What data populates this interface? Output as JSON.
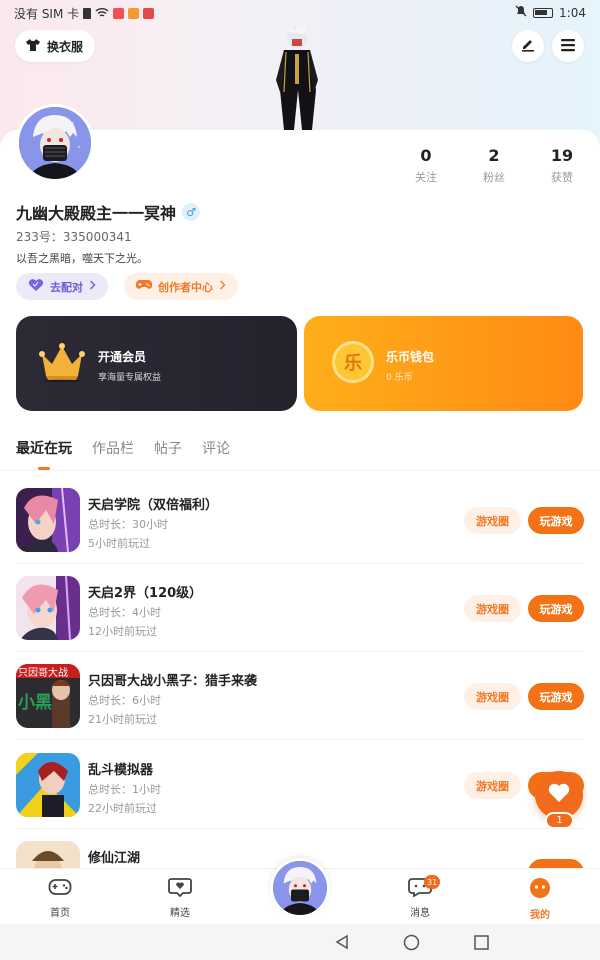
{
  "status_bar": {
    "carrier": "没有 SIM 卡",
    "time": "1:04"
  },
  "header": {
    "outfit_label": "换衣服"
  },
  "profile": {
    "name": "九幽大殿殿主一一冥神",
    "gender_symbol": "♂",
    "uid": "233号：335000341",
    "bio": "以吾之黑暗，噬天下之光。",
    "stats": [
      {
        "value": "0",
        "label": "关注"
      },
      {
        "value": "2",
        "label": "粉丝"
      },
      {
        "value": "19",
        "label": "获赞"
      }
    ],
    "match_label": "去配对",
    "creator_label": "创作者中心"
  },
  "cards": {
    "vip": {
      "title": "开通会员",
      "subtitle": "享海量专属权益"
    },
    "wallet": {
      "title": "乐币钱包",
      "subtitle": "0 乐币",
      "coin_glyph": "乐"
    }
  },
  "tabs": [
    "最近在玩",
    "作品栏",
    "帖子",
    "评论"
  ],
  "games": [
    {
      "name": "天启学院（双倍福利）",
      "duration": "总时长：30小时",
      "last": "5小时前玩过",
      "circle": "游戏圈",
      "play": "玩游戏"
    },
    {
      "name": "天启2界（120级）",
      "duration": "总时长：4小时",
      "last": "12小时前玩过",
      "circle": "游戏圈",
      "play": "玩游戏"
    },
    {
      "name": "只因哥大战小黑子：猎手来袭",
      "duration": "总时长：6小时",
      "last": "21小时前玩过",
      "circle": "游戏圈",
      "play": "玩游戏"
    },
    {
      "name": "乱斗模拟器",
      "duration": "总时长：1小时",
      "last": "22小时前玩过",
      "circle": "游戏圈",
      "play": "玩游戏"
    },
    {
      "name": "修仙江湖"
    }
  ],
  "thumb_texts": {
    "game3_a": "只因哥大战",
    "game3_b": "小黑子"
  },
  "like_count": "1",
  "bottom_nav": {
    "home": "首页",
    "featured": "精选",
    "messages": "消息",
    "mine": "我的",
    "messages_badge": "31"
  },
  "colors": {
    "accent": "#f27215",
    "vip_bg": "#2a2833",
    "wallet_bg": "#ff9a17"
  }
}
